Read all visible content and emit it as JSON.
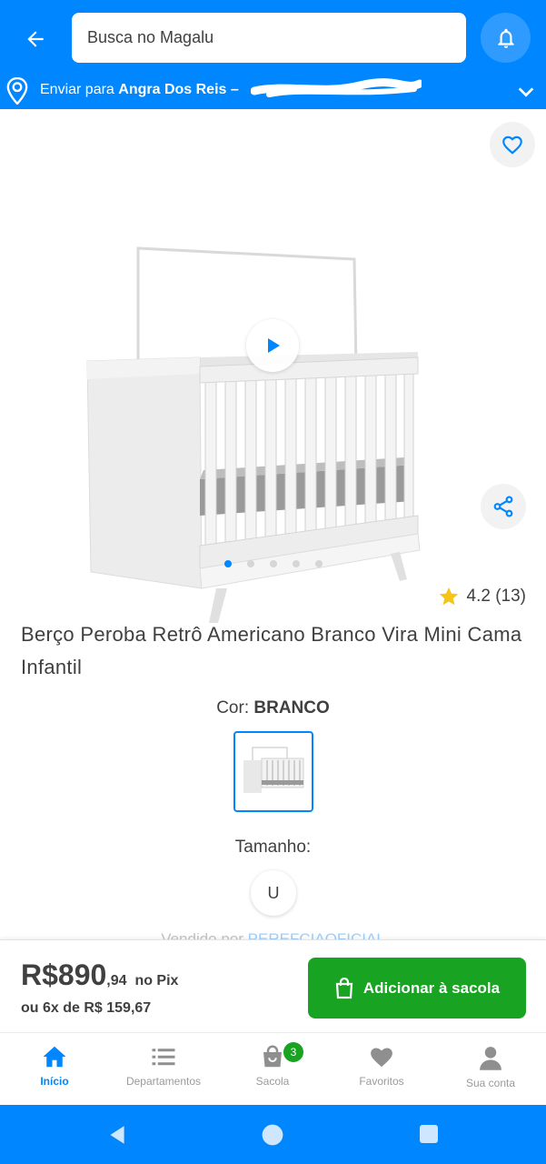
{
  "header": {
    "search_placeholder": "Busca no Magalu",
    "shipping_prefix": "Enviar para",
    "shipping_city": "Angra Dos Reis –"
  },
  "product": {
    "rating": "4.2 (13)",
    "title": "Berço Peroba Retrô Americano Branco Vira Mini Cama Infantil",
    "color_label": "Cor:",
    "color_value": "BRANCO",
    "size_label": "Tamanho:",
    "size_option": "U",
    "seller_prefix": "Vendido por",
    "seller_name": "PEREFCIAOFICIAL",
    "gallery_dots": 5,
    "gallery_active_index": 0
  },
  "buybar": {
    "price_main": "R$890",
    "price_cents": ",94",
    "price_suffix": "no Pix",
    "installments": "ou 6x de R$ 159,67",
    "add_button": "Adicionar à sacola"
  },
  "bottom_nav": {
    "items": [
      {
        "label": "Início",
        "icon": "home-icon",
        "active": true
      },
      {
        "label": "Departamentos",
        "icon": "menu-icon",
        "active": false
      },
      {
        "label": "Sacola",
        "icon": "bag-icon",
        "active": false,
        "badge": "3"
      },
      {
        "label": "Favoritos",
        "icon": "heart-icon",
        "active": false
      },
      {
        "label": "Sua conta",
        "icon": "user-icon",
        "active": false
      }
    ]
  },
  "colors": {
    "brand_blue": "#0086ff",
    "buy_green": "#18a322",
    "star": "#f5c518",
    "text": "#404040"
  }
}
